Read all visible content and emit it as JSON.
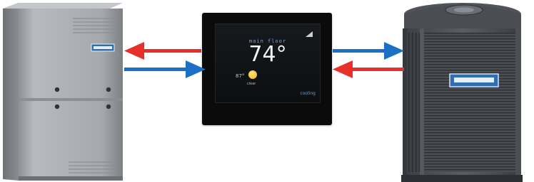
{
  "thermostat": {
    "zone": "main floor",
    "temperature": "74°",
    "outdoor_temperature": "87°",
    "weather_condition": "clear",
    "mode": "cooling"
  },
  "colors": {
    "heat_arrow": "#e8302a",
    "cool_arrow": "#1b6fc4"
  },
  "icons": [
    "furnace",
    "thermostat",
    "air-conditioner",
    "sun-icon",
    "signal-icon"
  ]
}
